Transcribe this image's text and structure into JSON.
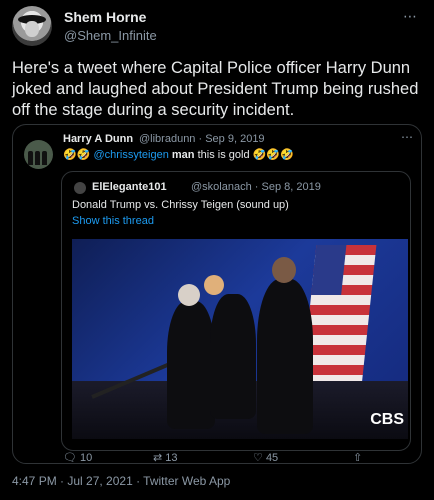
{
  "tweet": {
    "author": {
      "name": "Shem Horne",
      "handle": "@Shem_Infinite"
    },
    "more_icon": "more-icon",
    "text": "Here's a tweet where Capital Police officer Harry Dunn joked and laughed about President Trump being rushed off the stage during a security incident.",
    "timestamp": "4:47 PM · Jul 27, 2021 · Twitter Web App"
  },
  "quoted": {
    "author": {
      "name": "Harry A Dunn",
      "handle": "@libradunn",
      "date": "· Sep 9, 2019"
    },
    "emoji_prefix": "🤣🤣",
    "mention": "@chrissyteigen",
    "bold": "man",
    "rest": "this is gold",
    "emoji_suffix": "🤣🤣🤣",
    "actions": {
      "replies": "10",
      "retweets": "13",
      "likes": "45"
    }
  },
  "inner": {
    "author": {
      "name": "ElElegante101",
      "handle": "@skolanach",
      "date": "· Sep 8, 2019"
    },
    "text": "Donald Trump vs. Chrissy Teigen (sound up)",
    "link": "Show this thread",
    "video_logo": "CBS"
  }
}
